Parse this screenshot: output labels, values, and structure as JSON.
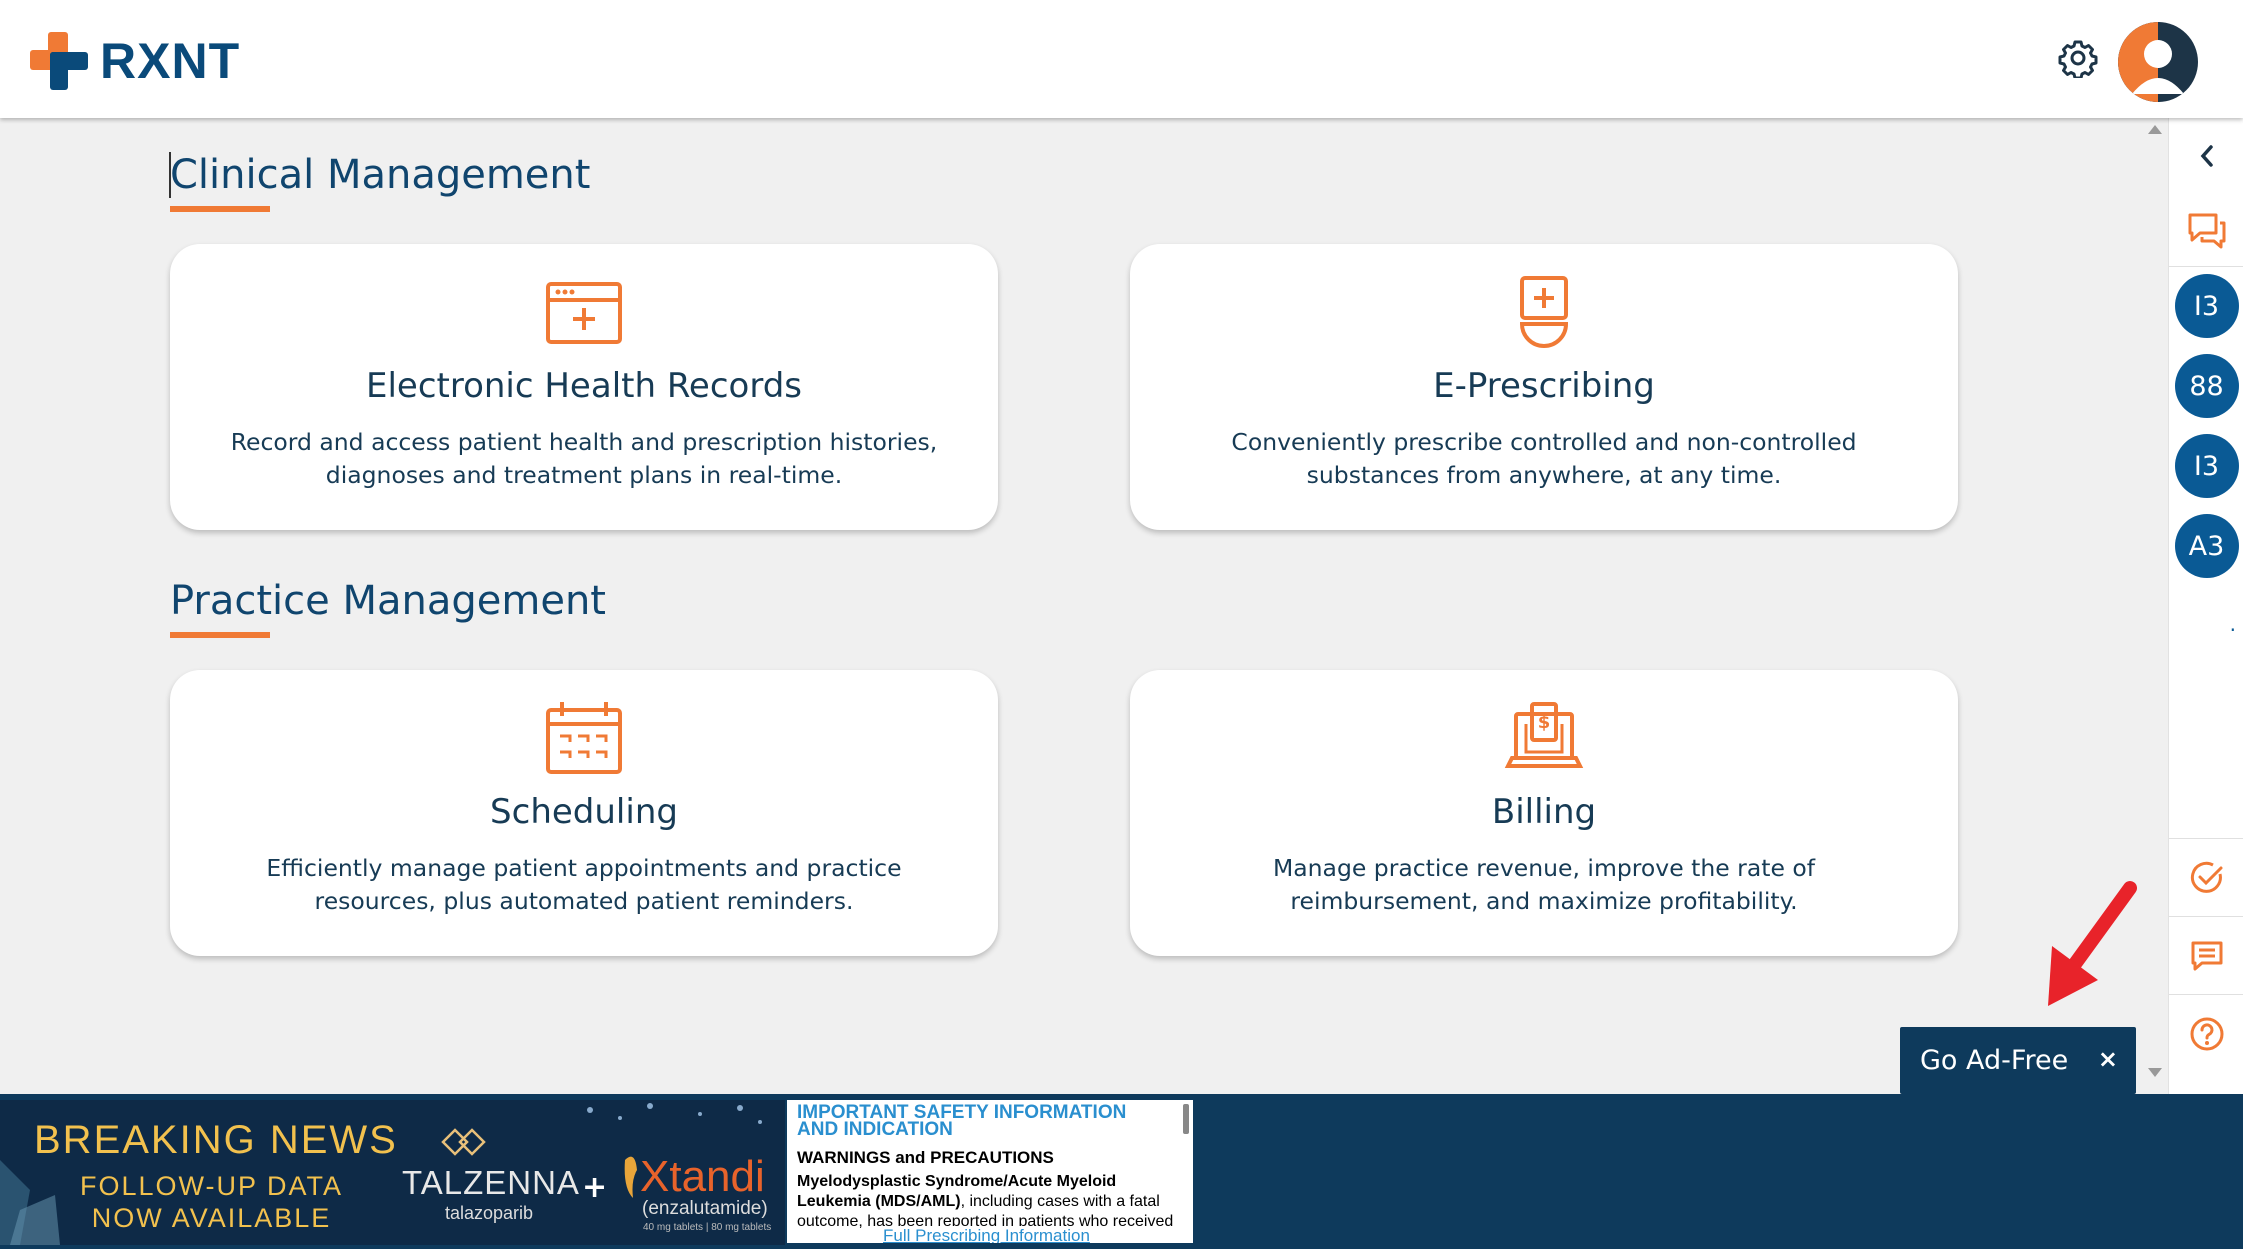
{
  "header": {
    "logo_text": "RXNT"
  },
  "sections": [
    {
      "title": "Clinical Management",
      "cards": [
        {
          "title": "Electronic Health Records",
          "desc_line1": "Record and access patient health and prescription histories,",
          "desc_line2": "diagnoses and treatment plans in real-time.",
          "icon": "health-records-icon"
        },
        {
          "title": "E-Prescribing",
          "desc_line1": "Conveniently prescribe controlled and non-controlled",
          "desc_line2": "substances from anywhere, at any time.",
          "icon": "prescription-icon"
        }
      ]
    },
    {
      "title": "Practice Management",
      "cards": [
        {
          "title": "Scheduling",
          "desc_line1": "Efficiently manage patient appointments and practice",
          "desc_line2": "resources, plus automated patient reminders.",
          "icon": "calendar-icon"
        },
        {
          "title": "Billing",
          "desc_line1": "Manage practice revenue, improve the rate of",
          "desc_line2": "reimbursement, and maximize profitability.",
          "icon": "billing-icon"
        }
      ]
    }
  ],
  "sidebar": {
    "circles": [
      "I3",
      "88",
      "I3",
      "A3"
    ],
    "dot": "."
  },
  "ad_free": {
    "label": "Go Ad-Free",
    "close": "×"
  },
  "ad": {
    "headline": "BREAKING NEWS",
    "sub_line1": "FOLLOW-UP DATA",
    "sub_line2": "NOW AVAILABLE",
    "brand1": "TALZENNA",
    "brand1_sub": "talazoparib",
    "plus": "+",
    "brand2": "Xtandi",
    "brand2_sub": "(enzalutamide)",
    "brand2_dose": "40 mg tablets | 80 mg tablets",
    "isi_title": "IMPORTANT SAFETY INFORMATION AND INDICATION",
    "isi_warnings": "WARNINGS and PRECAUTIONS",
    "isi_bold": "Myelodysplastic Syndrome/Acute Myeloid Leukemia (MDS/AML)",
    "isi_text": ", including cases with a fatal outcome, has been reported in patients who received",
    "isi_link": "Full Prescribing Information"
  },
  "colors": {
    "brand_blue": "#0a4a7a",
    "accent_orange": "#f07a35",
    "sidebar_circle": "#0a5a95",
    "ad_bar": "#0e3a5c"
  }
}
